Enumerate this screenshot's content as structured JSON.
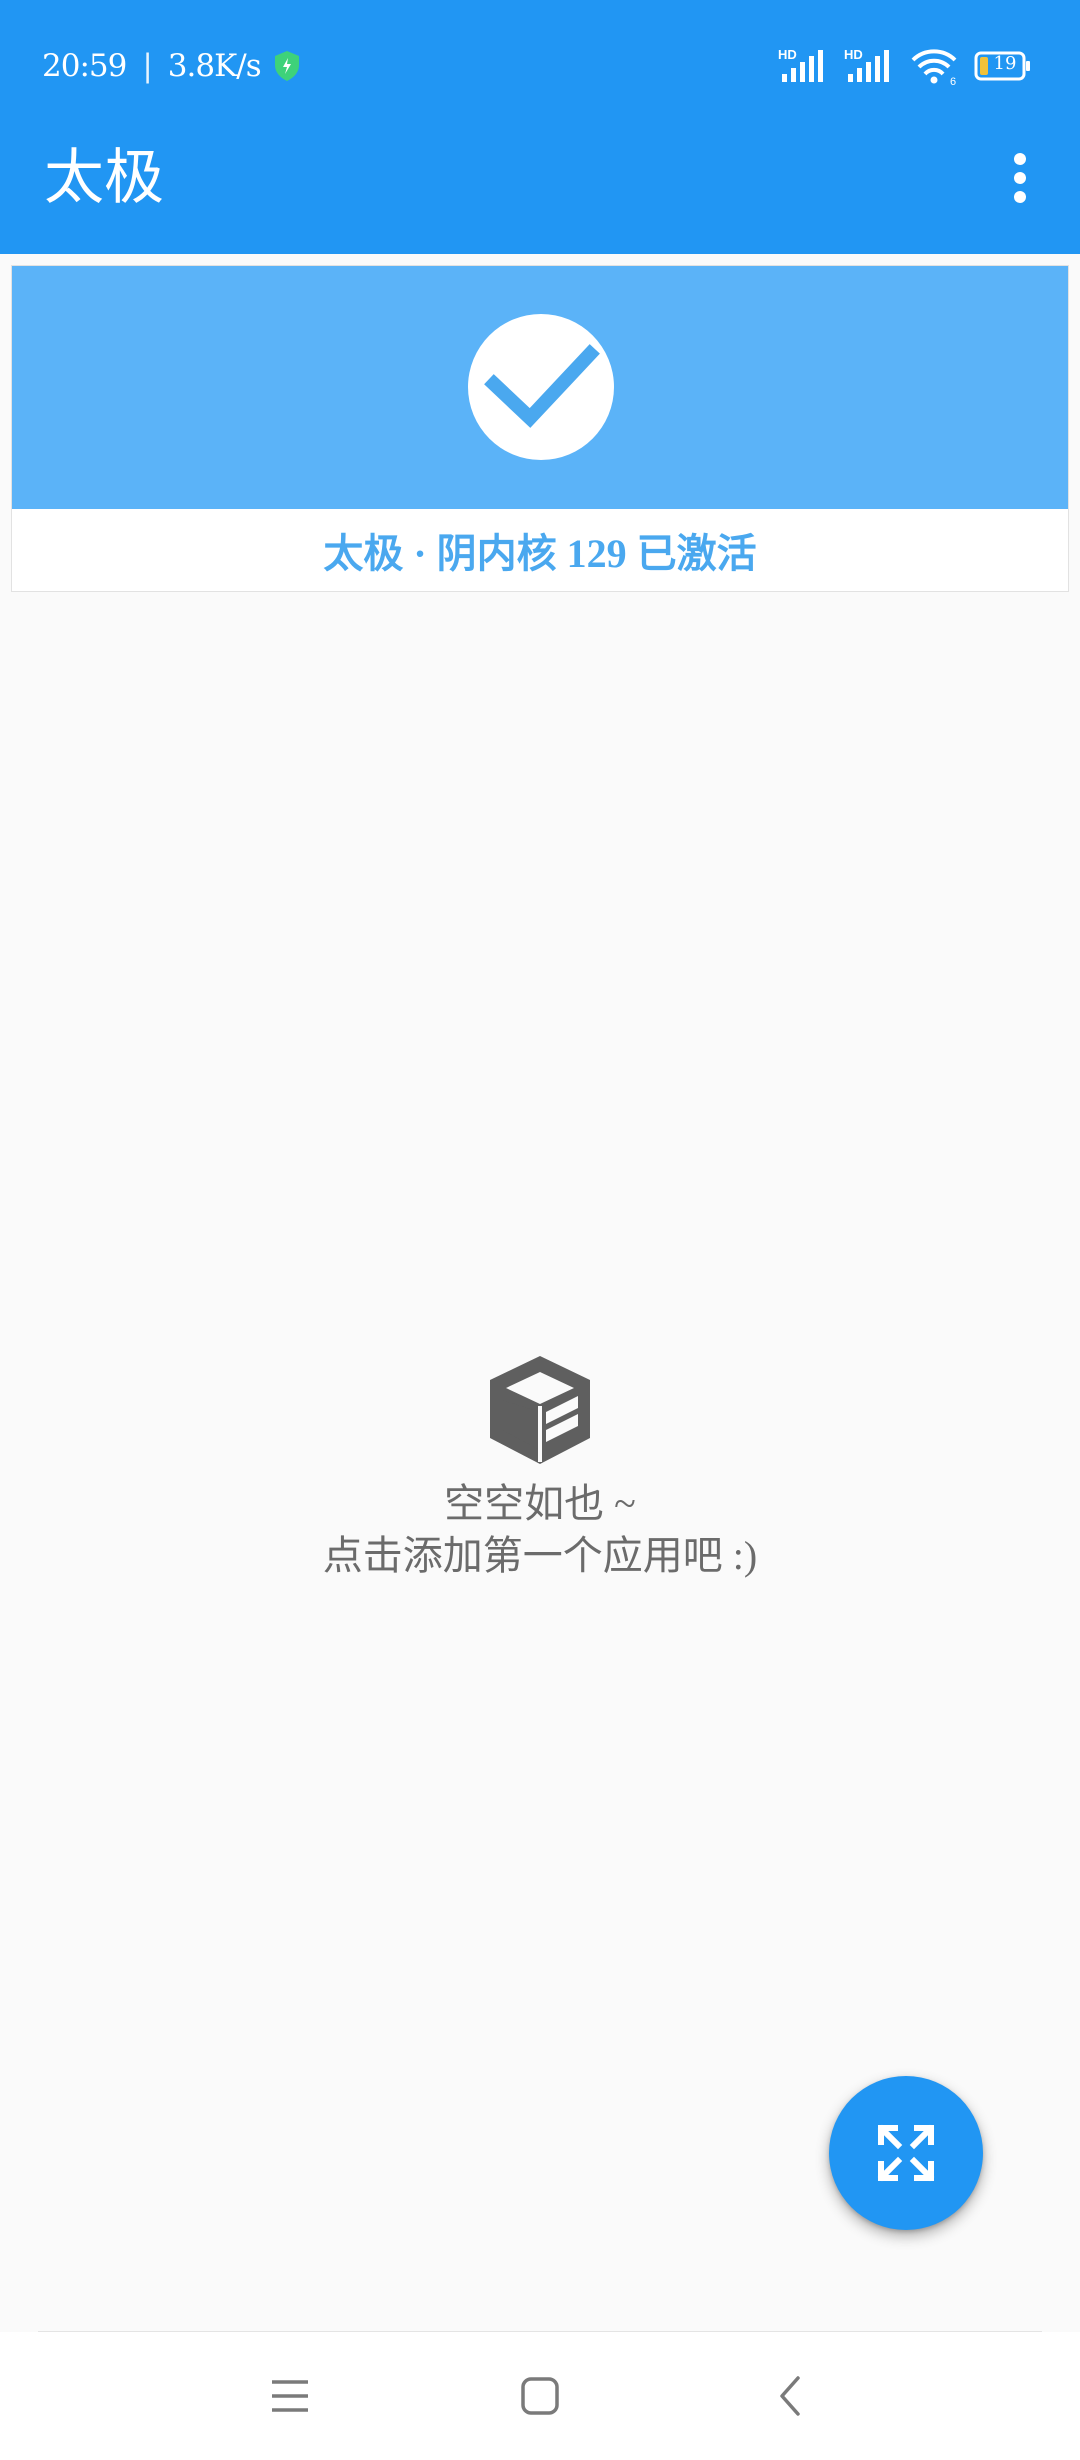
{
  "status_bar": {
    "time": "20:59",
    "separator": "|",
    "net_speed": "3.8K/s",
    "battery_level": "19",
    "network_1": "HD",
    "network_2": "HD",
    "wifi_badge": "6"
  },
  "app_bar": {
    "title": "太极",
    "menu_icon": "more-vert-icon"
  },
  "status_card": {
    "icon": "check-icon",
    "text": "太极 · 阴内核 129 已激活"
  },
  "empty_state": {
    "icon": "box-icon",
    "line1": "空空如也 ~",
    "line2": "点击添加第一个应用吧 :)"
  },
  "fab": {
    "icon": "expand-icon"
  },
  "nav_bar": {
    "items": [
      "menu-icon",
      "home-icon",
      "back-icon"
    ]
  },
  "colors": {
    "primary": "#2196f3",
    "card_banner": "#5bb3f8",
    "status_text": "#4aa8ef",
    "background": "#fafafa"
  }
}
